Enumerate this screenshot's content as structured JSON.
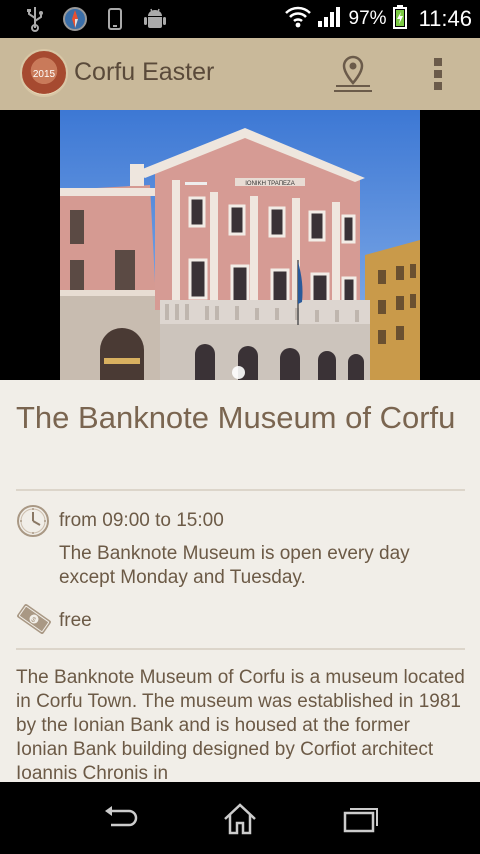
{
  "status_bar": {
    "icons_left": [
      "usb-icon",
      "compass-icon",
      "phone-icon",
      "android-icon"
    ],
    "battery_percent": "97%",
    "time": "11:46"
  },
  "action_bar": {
    "logo_text": "2015",
    "title": "Corfu Easter",
    "map_icon": "map-pin-icon",
    "overflow_icon": "overflow-menu-icon"
  },
  "hero": {
    "sign_text": "ΙΟΝΙΚΗ ΤΡΑΠΕΖΑ",
    "pager": {
      "count": 1,
      "active": 0
    }
  },
  "place": {
    "title": "The Banknote Museum of Corfu",
    "hours": "from 09:00 to 15:00",
    "hours_note": "The Banknote Museum is open every day except Monday and Tuesday.",
    "price": "free",
    "description": "The Banknote Museum of Corfu is a museum located in Corfu Town. The museum was established in 1981 by the Ionian Bank and is housed at the former Ionian Bank building designed by Corfiot architect Ioannis Chronis in"
  },
  "colors": {
    "action_bar": "#c9b99a",
    "content_bg": "#f1eee8",
    "title_text": "#7a6550",
    "body_text": "#6c5a46"
  },
  "nav_bar": {
    "icons": [
      "back-icon",
      "home-icon",
      "recent-apps-icon"
    ]
  }
}
